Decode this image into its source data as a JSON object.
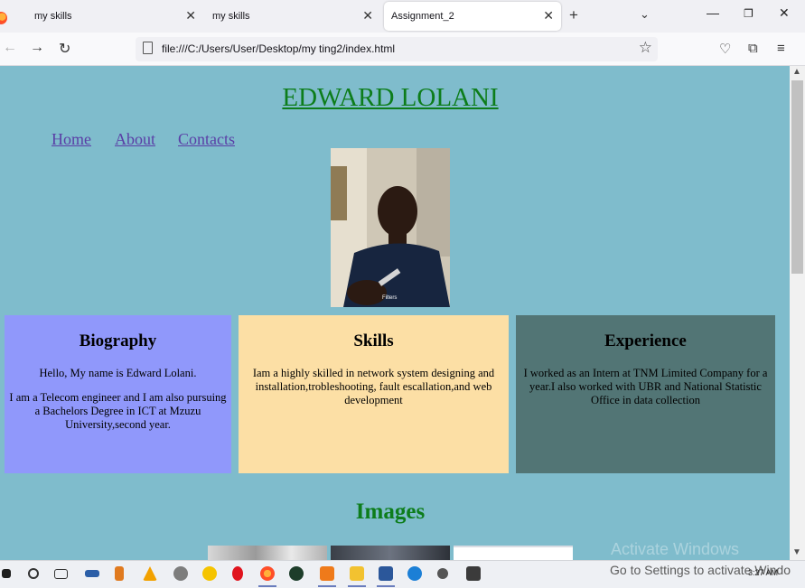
{
  "browser": {
    "tabs": [
      {
        "title": "my skills",
        "active": false
      },
      {
        "title": "my skills",
        "active": false
      },
      {
        "title": "Assignment_2",
        "active": true
      }
    ],
    "url": "file:///C:/Users/User/Desktop/my ting2/index.html"
  },
  "page": {
    "title": "EDWARD LOLANI",
    "nav": [
      "Home",
      "About",
      "Contacts"
    ],
    "photo_overlay_text": "Filters",
    "cards": [
      {
        "heading": "Biography",
        "paragraphs": [
          "Hello, My name is Edward Lolani.",
          "I am a Telecom engineer and I am also pursuing a Bachelors Degree in ICT at Mzuzu University,second year."
        ],
        "color": "#9098fb"
      },
      {
        "heading": "Skills",
        "paragraphs": [
          "Iam a highly skilled in network system designing and installation,trobleshooting, fault escallation,and web development"
        ],
        "color": "#fcdfa5"
      },
      {
        "heading": "Experience",
        "paragraphs": [
          "I worked as an Intern at TNM Limited Company for a year.I also worked with UBR and National Statistic Office in data collection"
        ],
        "color": "#527575"
      }
    ],
    "images_heading": "Images",
    "background_color": "#7fbccc",
    "accent_color": "#0d7d1b"
  },
  "os": {
    "activation_title": "Activate Windows",
    "activation_text": "Go to Settings to activate Windo",
    "clock": "3:27 AM"
  }
}
